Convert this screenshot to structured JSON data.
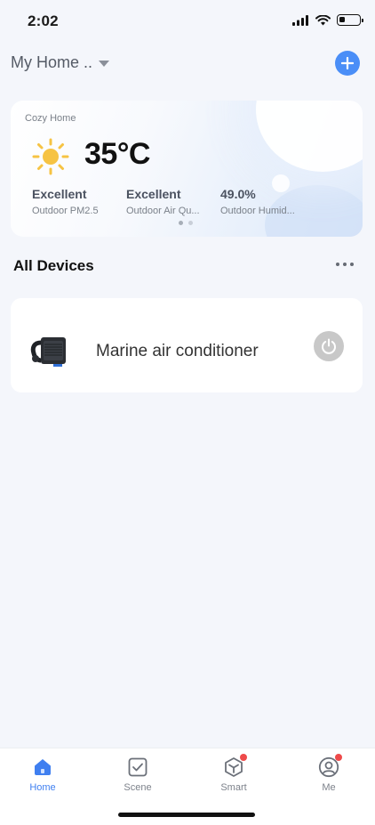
{
  "status_bar": {
    "time": "2:02",
    "battery_level": 0.3
  },
  "header": {
    "home_name": "My Home ..",
    "add_icon": "plus-icon"
  },
  "weather": {
    "home_label": "Cozy Home",
    "temperature": "35°C",
    "weather_icon": "sun-icon",
    "metrics": [
      {
        "value": "Excellent",
        "label": "Outdoor PM2.5"
      },
      {
        "value": "Excellent",
        "label": "Outdoor Air Qu..."
      },
      {
        "value": "49.0%",
        "label": "Outdoor Humid..."
      }
    ],
    "pager": {
      "pages": 2,
      "current": 1
    }
  },
  "devices_section": {
    "title": "All Devices",
    "devices": [
      {
        "name": "Marine air conditioner",
        "power_state": "off"
      }
    ]
  },
  "tab_bar": {
    "tabs": [
      {
        "label": "Home",
        "icon": "home-icon",
        "active": true,
        "badge": false
      },
      {
        "label": "Scene",
        "icon": "checkbox-icon",
        "active": false,
        "badge": false
      },
      {
        "label": "Smart",
        "icon": "cube-icon",
        "active": false,
        "badge": true
      },
      {
        "label": "Me",
        "icon": "profile-icon",
        "active": false,
        "badge": true
      }
    ]
  },
  "colors": {
    "accent": "#4a8ef7",
    "badge": "#ee4a4a",
    "sun": "#f6c343",
    "background": "#f4f6fb"
  }
}
